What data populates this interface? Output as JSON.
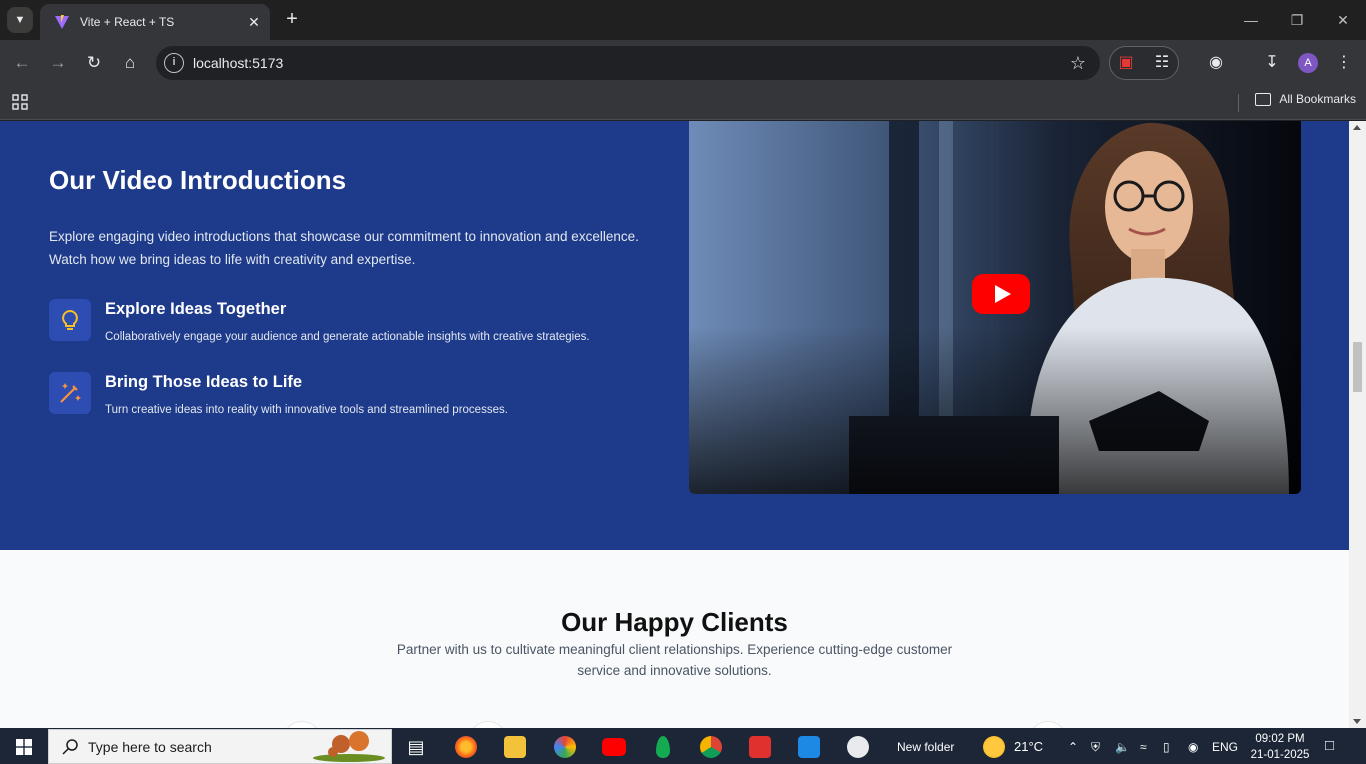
{
  "browser": {
    "tab_title": "Vite + React + TS",
    "url": "localhost:5173",
    "all_bookmarks": "All Bookmarks",
    "profile_initial": "A"
  },
  "video_section": {
    "title": "Our Video Introductions",
    "description": "Explore engaging video introductions that showcase our commitment to innovation and excellence. Watch how we bring ideas to life with creativity and expertise.",
    "features": [
      {
        "title": "Explore Ideas Together",
        "text": "Collaboratively engage your audience and generate actionable insights with creative strategies.",
        "icon": "lightbulb-icon"
      },
      {
        "title": "Bring Those Ideas to Life",
        "text": "Turn creative ideas into reality with innovative tools and streamlined processes.",
        "icon": "magic-wand-icon"
      }
    ]
  },
  "clients_section": {
    "title": "Our Happy Clients",
    "subtitle": "Partner with us to cultivate meaningful client relationships. Experience cutting-edge customer service and innovative solutions."
  },
  "taskbar": {
    "search_placeholder": "Type here to search",
    "folder_label": "New folder",
    "temperature": "21°C",
    "language": "ENG",
    "time": "09:02 PM",
    "date": "21-01-2025"
  }
}
